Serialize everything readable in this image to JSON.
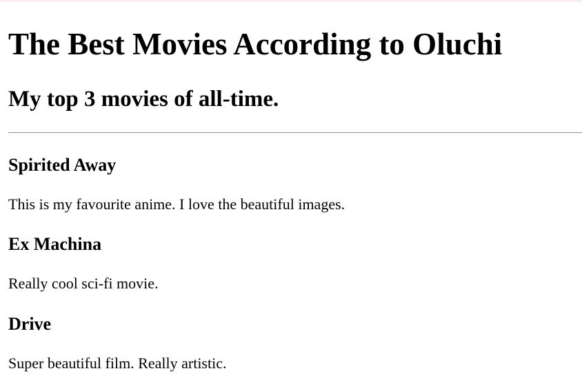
{
  "header": {
    "title": "The Best Movies According to Oluchi",
    "subtitle": "My top 3 movies of all-time."
  },
  "movies": [
    {
      "title": "Spirited Away",
      "description": "This is my favourite anime. I love the beautiful images."
    },
    {
      "title": "Ex Machina",
      "description": "Really cool sci-fi movie."
    },
    {
      "title": "Drive",
      "description": "Super beautiful film. Really artistic."
    }
  ]
}
